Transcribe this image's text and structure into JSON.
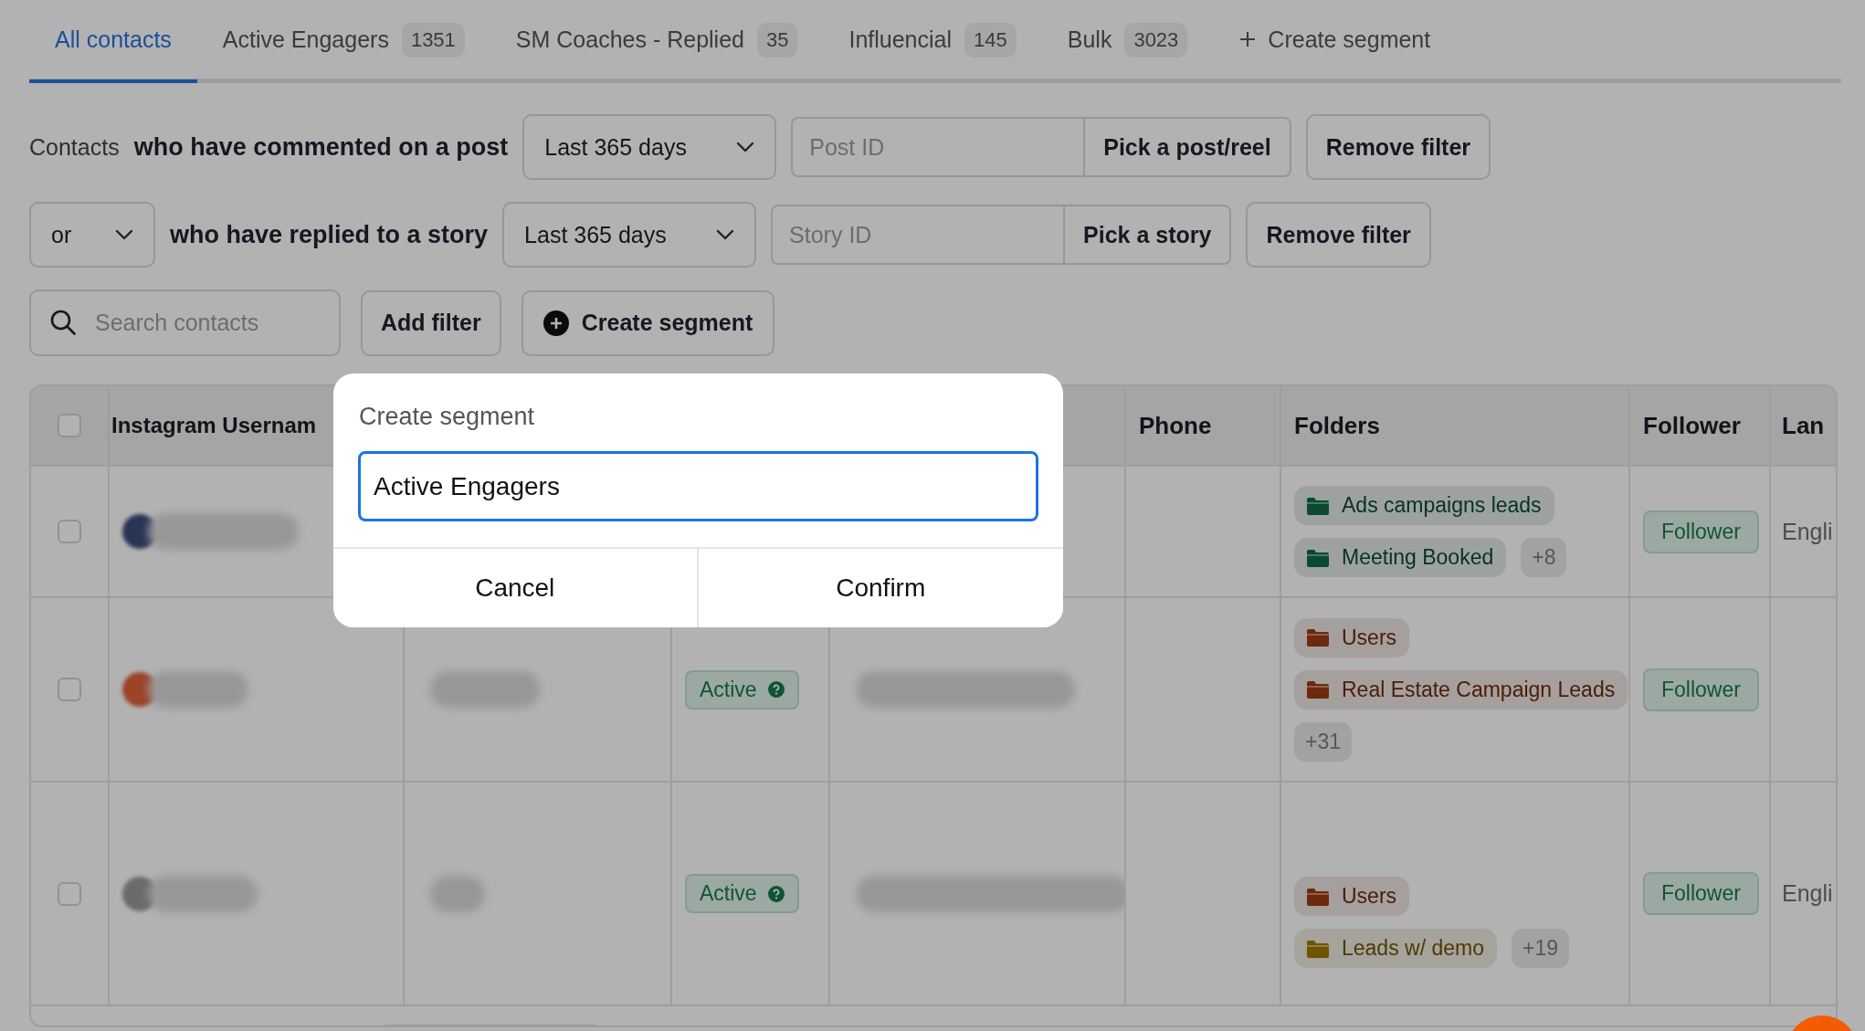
{
  "tabs": [
    {
      "label": "All contacts",
      "selected": true
    },
    {
      "label": "Active Engagers",
      "count": "1351",
      "selected": false
    },
    {
      "label": "SM Coaches - Replied",
      "count": "35",
      "selected": false
    },
    {
      "label": "Influencial",
      "count": "145",
      "selected": false
    },
    {
      "label": "Bulk",
      "count": "3023",
      "selected": false
    }
  ],
  "create_segment_tab": {
    "label": "Create segment"
  },
  "filters": [
    {
      "prefix": {
        "kind": "text",
        "label": "Contacts"
      },
      "condition": "who have commented on a post",
      "period": "Last 365 days",
      "id_placeholder": "Post ID",
      "pick_button": "Pick a post/reel",
      "remove_button": "Remove filter"
    },
    {
      "prefix": {
        "kind": "dropdown",
        "label": "or"
      },
      "condition": "who have replied to a story",
      "period": "Last 365 days",
      "id_placeholder": "Story ID",
      "pick_button": "Pick a story",
      "remove_button": "Remove filter"
    }
  ],
  "toolbar": {
    "search_placeholder": "Search contacts",
    "add_filter": "Add filter",
    "create_segment": "Create segment"
  },
  "table": {
    "header_checked": false,
    "columns": {
      "username": "Instagram Usernam",
      "phone": "Phone",
      "folders": "Folders",
      "follower": "Follower",
      "language": "Lan"
    },
    "rows": [
      {
        "checked": false,
        "folders": [
          {
            "label": "Ads campaigns leads",
            "color": "#0b4a30"
          },
          {
            "label": "Meeting Booked",
            "color": "#0b4a30"
          }
        ],
        "more": "+8",
        "follower": "Follower",
        "language": "Engli"
      },
      {
        "checked": false,
        "status": "Active",
        "folders": [
          {
            "label": "Users",
            "color": "#6b2a0c"
          },
          {
            "label": "Real Estate Campaign Leads",
            "color": "#6b2a0c"
          }
        ],
        "more": "+31",
        "follower": "Follower"
      },
      {
        "checked": false,
        "status": "Active",
        "folders": [
          {
            "label": "Users",
            "color": "#6b2a0c"
          },
          {
            "label": "Leads w/ demo",
            "color": "#6e5400"
          }
        ],
        "more": "+19",
        "follower": "Follower",
        "language": "Engli"
      }
    ]
  },
  "modal": {
    "title": "Create segment",
    "value": "Active Engagers",
    "cancel": "Cancel",
    "confirm": "Confirm"
  }
}
